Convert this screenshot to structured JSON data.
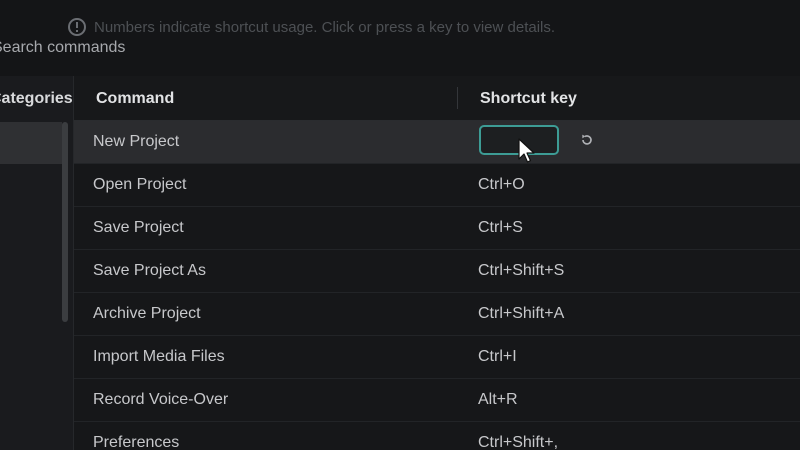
{
  "notice": {
    "icon": "info-icon",
    "text": "Numbers indicate shortcut usage. Click or press a key to view details."
  },
  "search": {
    "placeholder": "Search commands"
  },
  "left_panel": {
    "header": "Categories"
  },
  "table": {
    "headers": {
      "command": "Command",
      "shortcut": "Shortcut key"
    },
    "rows": [
      {
        "command": "New Project",
        "shortcut": "",
        "selected": true
      },
      {
        "command": "Open Project",
        "shortcut": "Ctrl+O"
      },
      {
        "command": "Save Project",
        "shortcut": "Ctrl+S"
      },
      {
        "command": "Save Project As",
        "shortcut": "Ctrl+Shift+S"
      },
      {
        "command": "Archive Project",
        "shortcut": "Ctrl+Shift+A"
      },
      {
        "command": "Import Media Files",
        "shortcut": "Ctrl+I"
      },
      {
        "command": "Record Voice-Over",
        "shortcut": "Alt+R"
      },
      {
        "command": "Preferences",
        "shortcut": "Ctrl+Shift+,"
      }
    ]
  },
  "colors": {
    "accent": "#3d9c95",
    "background": "#161719",
    "selected_row": "#2b2c2f"
  }
}
